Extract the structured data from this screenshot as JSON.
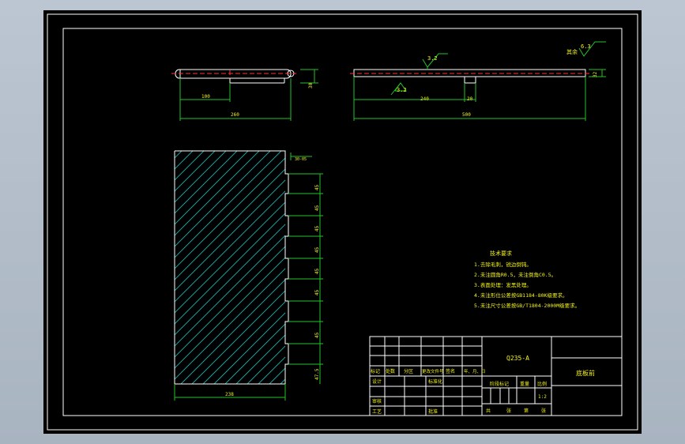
{
  "dims": {
    "left_view_1": "100",
    "left_view_2": "260",
    "left_view_height": "30",
    "right_view_1": "240",
    "right_view_2": "20",
    "right_view_total": "500",
    "right_view_height": "32",
    "plan_width": "238",
    "plan_top_gap": "30-05",
    "plan_pitch": [
      "45",
      "45",
      "45",
      "45",
      "45",
      "45",
      "45"
    ],
    "plan_bottom": "47.5"
  },
  "roughness": {
    "top_mark": "3.2",
    "bottom_mark": "3.2",
    "corner_label": "其余",
    "corner_value": "6.3"
  },
  "notes": {
    "title": "技术要求",
    "items": [
      "1.去除毛刺，锐边倒钝。",
      "2.未注圆角R0.5，未注倒角C0.5。",
      "3.表面处理：发黑处理。",
      "4.未注形位公差按GB1184-80K级要求。",
      "5.未注尺寸公差按GB/T1804-2000M级要求。"
    ]
  },
  "title_block": {
    "material": "Q235-A",
    "part_name": "底板前",
    "row_headers": [
      "标记",
      "处数",
      "分区",
      "更改文件号",
      "签名",
      "年、月、日"
    ],
    "designer": "设计",
    "standardize": "标准化",
    "stage_mark": "阶段标记",
    "weight": "重量",
    "scale_label": "比例",
    "scale_value": "1:2",
    "review": "审核",
    "process": "工艺",
    "approve": "批准",
    "sheets_total": "共",
    "sheets_label": "张",
    "sheet_index": "第",
    "sheet_label": "张"
  }
}
